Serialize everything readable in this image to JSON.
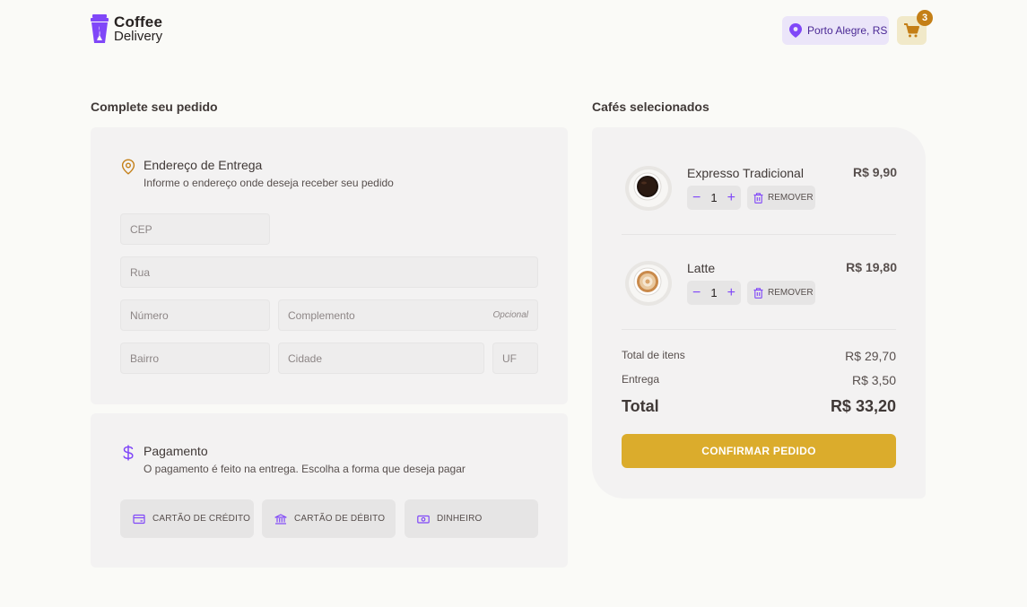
{
  "header": {
    "logo_line1": "Coffee",
    "logo_line2": "Delivery",
    "location": "Porto Alegre, RS",
    "cart_count": "3"
  },
  "colors": {
    "purple": "#8047F8",
    "yellow": "#DBAC2C",
    "yellow_dark": "#C47F17",
    "purple_light": "#EBE5F9",
    "yellow_light": "#F1E9C9"
  },
  "order": {
    "title": "Complete seu pedido",
    "address": {
      "icon": "map-pin-icon",
      "title": "Endereço de Entrega",
      "subtitle": "Informe o endereço onde deseja receber seu pedido",
      "fields": {
        "cep": "CEP",
        "rua": "Rua",
        "numero": "Número",
        "complemento": "Complemento",
        "complemento_optional": "Opcional",
        "bairro": "Bairro",
        "cidade": "Cidade",
        "uf": "UF"
      }
    },
    "payment": {
      "icon": "dollar-sign-icon",
      "title": "Pagamento",
      "subtitle": "O pagamento é feito na entrega. Escolha a forma que deseja pagar",
      "options": [
        "CARTÃO DE CRÉDITO",
        "CARTÃO DE DÉBITO",
        "DINHEIRO"
      ]
    }
  },
  "summary": {
    "title": "Cafés selecionados",
    "items": [
      {
        "name": "Expresso Tradicional",
        "price": "R$ 9,90",
        "qty": "1",
        "remove": "REMOVER",
        "minus": "−",
        "plus": "+"
      },
      {
        "name": "Latte",
        "price": "R$ 19,80",
        "qty": "1",
        "remove": "REMOVER",
        "minus": "−",
        "plus": "+"
      }
    ],
    "items_total_label": "Total de itens",
    "items_total": "R$ 29,70",
    "delivery_label": "Entrega",
    "delivery": "R$ 3,50",
    "total_label": "Total",
    "total": "R$ 33,20",
    "confirm": "CONFIRMAR PEDIDO"
  }
}
